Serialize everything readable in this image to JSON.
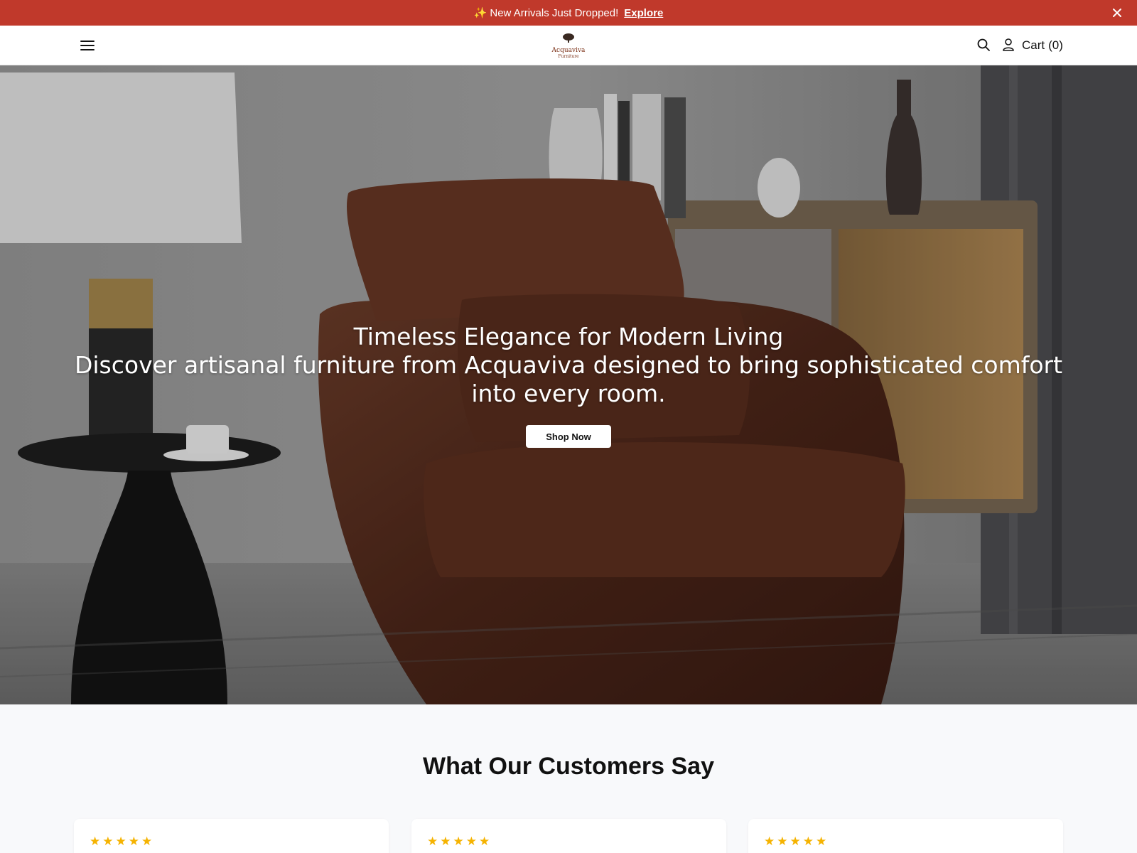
{
  "announcement": {
    "sparkle": "✨",
    "text": "New Arrivals Just Dropped!",
    "link_label": "Explore"
  },
  "header": {
    "logo_brand": "Acquaviva",
    "logo_sub": "Furniture",
    "cart_label": "Cart",
    "cart_count": "(0)"
  },
  "hero": {
    "title": "Timeless Elegance for Modern Living",
    "subtitle": "Discover artisanal furniture from Acquaviva designed to bring sophisticated comfort into every room.",
    "cta_label": "Shop Now"
  },
  "testimonials": {
    "title": "What Our Customers Say",
    "cards": [
      {
        "stars": "★★★★★",
        "rating": 5
      },
      {
        "stars": "★★★★★",
        "rating": 5
      },
      {
        "stars": "★★★★★",
        "rating": 5
      }
    ]
  },
  "colors": {
    "announcement_bg": "#c0392b",
    "star": "#f5b301",
    "brand": "#7a2e14"
  },
  "icons": [
    "menu-icon",
    "search-icon",
    "account-icon",
    "close-icon",
    "logo-tree-icon"
  ]
}
